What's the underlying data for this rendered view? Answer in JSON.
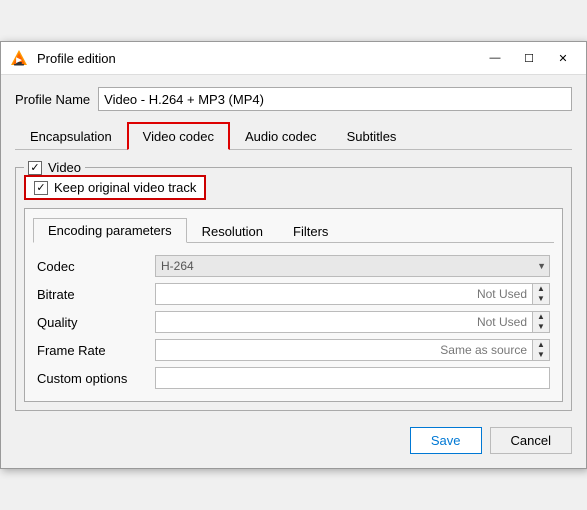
{
  "window": {
    "title": "Profile edition",
    "icon": "vlc"
  },
  "titlebar": {
    "minimize_label": "—",
    "maximize_label": "☐",
    "close_label": "✕"
  },
  "profile_name": {
    "label": "Profile Name",
    "value": "Video - H.264 + MP3 (MP4)"
  },
  "main_tabs": [
    {
      "id": "encapsulation",
      "label": "Encapsulation",
      "active": false
    },
    {
      "id": "video_codec",
      "label": "Video codec",
      "active": true
    },
    {
      "id": "audio_codec",
      "label": "Audio codec",
      "active": false
    },
    {
      "id": "subtitles",
      "label": "Subtitles",
      "active": false
    }
  ],
  "video_section": {
    "label": "Video",
    "keep_track": {
      "checked": true,
      "label": "Keep original video track"
    }
  },
  "sub_tabs": [
    {
      "id": "encoding",
      "label": "Encoding parameters",
      "active": true
    },
    {
      "id": "resolution",
      "label": "Resolution",
      "active": false
    },
    {
      "id": "filters",
      "label": "Filters",
      "active": false
    }
  ],
  "params": {
    "codec": {
      "label": "Codec",
      "value": "H-264",
      "type": "select"
    },
    "bitrate": {
      "label": "Bitrate",
      "value": "Not Used",
      "type": "spin"
    },
    "quality": {
      "label": "Quality",
      "value": "Not Used",
      "type": "spin"
    },
    "frame_rate": {
      "label": "Frame Rate",
      "value": "Same as source",
      "type": "spin"
    },
    "custom_options": {
      "label": "Custom options",
      "value": "",
      "type": "text"
    }
  },
  "footer": {
    "save_label": "Save",
    "cancel_label": "Cancel"
  }
}
